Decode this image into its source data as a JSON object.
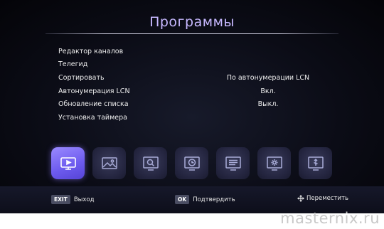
{
  "screen": {
    "title": "Программы"
  },
  "menu": {
    "items": [
      {
        "label": "Редактор каналов",
        "value": ""
      },
      {
        "label": "Телегид",
        "value": ""
      },
      {
        "label": "Сортировать",
        "value": "По автонумерации LCN"
      },
      {
        "label": "Автонумерация LCN",
        "value": "Вкл."
      },
      {
        "label": "Обновление списка",
        "value": "Выкл."
      },
      {
        "label": "Установка таймера",
        "value": ""
      }
    ]
  },
  "icons": [
    {
      "name": "tv-icon",
      "selected": true
    },
    {
      "name": "picture-icon",
      "selected": false
    },
    {
      "name": "search-icon",
      "selected": false
    },
    {
      "name": "clock-icon",
      "selected": false
    },
    {
      "name": "list-icon",
      "selected": false
    },
    {
      "name": "settings-icon",
      "selected": false
    },
    {
      "name": "usb-icon",
      "selected": false
    }
  ],
  "hints": {
    "exit_key": "EXIT",
    "exit_label": "Выход",
    "ok_key": "OK",
    "ok_label": "Подтвердить",
    "move_label": "Переместить"
  },
  "watermark": "masternix.ru",
  "colors": {
    "title": "#c7b8ff",
    "active_tile": "#7a68f0",
    "tile": "#2a2b46",
    "background": "#0b0c16"
  }
}
